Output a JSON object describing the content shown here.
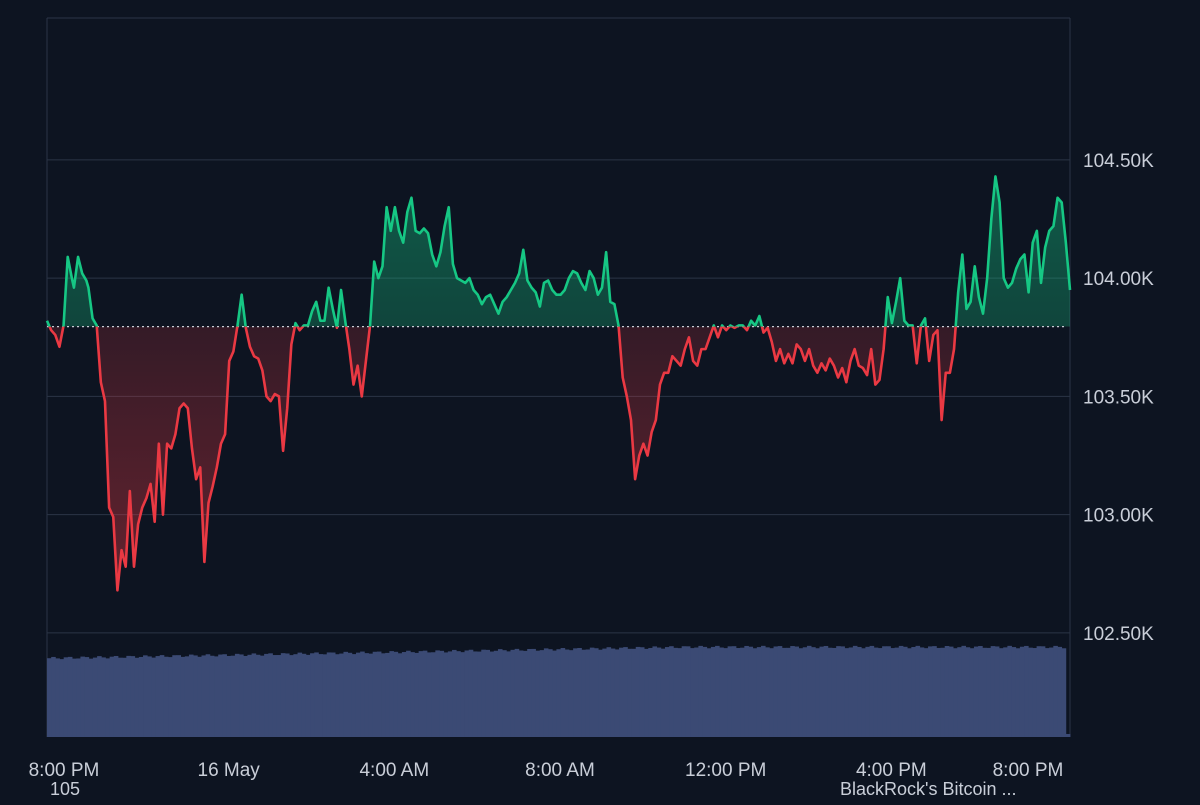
{
  "chart_data": {
    "type": "area",
    "baseline": 103795,
    "ylim": [
      102060,
      105100
    ],
    "y_ticks": [
      "104.50K",
      "104.00K",
      "103.50K",
      "103.00K",
      "102.50K"
    ],
    "y_tick_values": [
      104500,
      104000,
      103500,
      103000,
      102500
    ],
    "x_labels": [
      "8:00 PM",
      "16 May",
      "4:00 AM",
      "8:00 AM",
      "12:00 PM",
      "4:00 PM",
      "8:00 PM"
    ],
    "x_label_positions_hours": [
      0,
      4,
      8,
      12,
      16,
      20,
      24
    ],
    "x_range_hours": [
      0,
      24.7
    ],
    "price_series": {
      "x_hours": [
        0,
        0.1,
        0.2,
        0.3,
        0.4,
        0.5,
        0.6,
        0.65,
        0.75,
        0.85,
        0.95,
        1.0,
        1.1,
        1.2,
        1.3,
        1.4,
        1.5,
        1.6,
        1.7,
        1.8,
        1.9,
        2.0,
        2.1,
        2.2,
        2.3,
        2.4,
        2.5,
        2.6,
        2.7,
        2.8,
        2.9,
        3.0,
        3.1,
        3.2,
        3.3,
        3.4,
        3.5,
        3.6,
        3.7,
        3.8,
        3.9,
        4.0,
        4.1,
        4.2,
        4.3,
        4.4,
        4.5,
        4.6,
        4.7,
        4.8,
        4.9,
        5.0,
        5.1,
        5.2,
        5.3,
        5.4,
        5.5,
        5.6,
        5.7,
        5.8,
        5.9,
        6.0,
        6.1,
        6.2,
        6.3,
        6.4,
        6.5,
        6.6,
        6.7,
        6.8,
        6.9,
        7.0,
        7.1,
        7.2,
        7.3,
        7.4,
        7.5,
        7.6,
        7.7,
        7.8,
        7.9,
        8.0,
        8.1,
        8.2,
        8.3,
        8.4,
        8.5,
        8.6,
        8.7,
        8.8,
        8.9,
        9.0,
        9.1,
        9.2,
        9.3,
        9.4,
        9.5,
        9.6,
        9.7,
        9.8,
        9.9,
        10.0,
        10.1,
        10.2,
        10.3,
        10.4,
        10.5,
        10.6,
        10.7,
        10.8,
        10.9,
        11.0,
        11.1,
        11.2,
        11.3,
        11.4,
        11.5,
        11.6,
        11.7,
        11.8,
        11.9,
        12.0,
        12.1,
        12.2,
        12.3,
        12.4,
        12.5,
        12.6,
        12.7,
        12.8,
        12.9,
        13.0,
        13.1,
        13.2,
        13.3,
        13.4,
        13.5,
        13.6,
        13.7,
        13.8,
        13.9,
        14.0,
        14.1,
        14.2,
        14.3,
        14.4,
        14.5,
        14.6,
        14.7,
        14.8,
        14.9,
        15.0,
        15.1,
        15.2,
        15.3,
        15.4,
        15.5,
        15.6,
        15.7,
        15.8,
        15.9,
        16.0,
        16.1,
        16.2,
        16.3,
        16.4,
        16.5,
        16.6,
        16.7,
        16.8,
        16.9,
        17.0,
        17.1,
        17.2,
        17.3,
        17.4,
        17.5,
        17.6,
        17.7,
        17.8,
        17.9,
        18.0,
        18.1,
        18.2,
        18.3,
        18.4,
        18.5,
        18.6,
        18.7,
        18.8,
        18.9,
        19.0,
        19.1,
        19.2,
        19.3,
        19.4,
        19.5,
        19.6,
        19.7,
        19.8,
        19.9,
        20.0,
        20.1,
        20.2,
        20.3,
        20.4,
        20.5,
        20.6,
        20.7,
        20.8,
        20.9,
        21.0,
        21.1,
        21.2,
        21.3,
        21.4,
        21.5,
        21.6,
        21.7,
        21.8,
        21.9,
        22.0,
        22.1,
        22.2,
        22.3,
        22.4,
        22.5,
        22.6,
        22.7,
        22.8,
        22.9,
        23.0,
        23.1,
        23.2,
        23.3,
        23.4,
        23.5,
        23.6,
        23.7,
        23.8,
        23.9,
        24.0,
        24.1,
        24.2,
        24.3,
        24.4,
        24.5,
        24.6,
        24.7
      ],
      "y_values": [
        103820,
        103780,
        103760,
        103710,
        103800,
        104090,
        104000,
        103960,
        104090,
        104020,
        103990,
        103960,
        103830,
        103800,
        103560,
        103480,
        103030,
        102990,
        102680,
        102850,
        102780,
        103100,
        102780,
        102960,
        103030,
        103070,
        103130,
        102970,
        103300,
        103000,
        103300,
        103280,
        103340,
        103450,
        103470,
        103450,
        103280,
        103150,
        103200,
        102800,
        103050,
        103120,
        103200,
        103300,
        103340,
        103650,
        103690,
        103800,
        103930,
        103790,
        103710,
        103670,
        103660,
        103610,
        103500,
        103480,
        103510,
        103500,
        103270,
        103450,
        103720,
        103810,
        103780,
        103800,
        103800,
        103860,
        103900,
        103820,
        103820,
        103960,
        103870,
        103790,
        103950,
        103820,
        103700,
        103550,
        103630,
        103500,
        103650,
        103800,
        104070,
        104000,
        104050,
        104300,
        104200,
        104300,
        104200,
        104150,
        104280,
        104340,
        104200,
        104190,
        104210,
        104190,
        104100,
        104050,
        104110,
        104220,
        104300,
        104060,
        104000,
        103990,
        103980,
        104000,
        103950,
        103930,
        103890,
        103920,
        103930,
        103890,
        103850,
        103900,
        103920,
        103950,
        103980,
        104020,
        104120,
        103990,
        103960,
        103940,
        103880,
        103980,
        103990,
        103950,
        103930,
        103930,
        103950,
        104000,
        104030,
        104020,
        103980,
        103950,
        104030,
        104000,
        103930,
        103960,
        104110,
        103900,
        103890,
        103800,
        103580,
        103500,
        103400,
        103150,
        103250,
        103300,
        103250,
        103350,
        103400,
        103550,
        103600,
        103600,
        103670,
        103650,
        103630,
        103700,
        103750,
        103650,
        103630,
        103700,
        103700,
        103750,
        103800,
        103750,
        103800,
        103780,
        103800,
        103790,
        103800,
        103800,
        103780,
        103820,
        103800,
        103840,
        103770,
        103790,
        103730,
        103650,
        103700,
        103640,
        103680,
        103640,
        103720,
        103700,
        103650,
        103700,
        103630,
        103600,
        103640,
        103610,
        103660,
        103630,
        103580,
        103620,
        103560,
        103650,
        103700,
        103630,
        103620,
        103590,
        103700,
        103550,
        103570,
        103700,
        103920,
        103810,
        103900,
        104000,
        103820,
        103800,
        103800,
        103640,
        103800,
        103830,
        103650,
        103760,
        103780,
        103400,
        103600,
        103600,
        103700,
        103940,
        104100,
        103870,
        103900,
        104050,
        103920,
        103850,
        104000,
        104250,
        104430,
        104320,
        104000,
        103960,
        103980,
        104040,
        104080,
        104100,
        103940,
        104150,
        104200,
        103980,
        104130,
        104200,
        104220,
        104340,
        104320,
        104150,
        103950,
        104000,
        103870
      ]
    },
    "volume_series": {
      "bar_count": 245,
      "level_range": [
        0.78,
        0.91
      ],
      "last_bar_level": 0.03
    },
    "baseline_color": "#c8ccd4",
    "up_color": "#16c784",
    "down_color": "#ea3943",
    "volume_color": "#3b4a74",
    "grid_color": "#2b3446",
    "axis_text_color": "#c9ced8",
    "background_color": "#0d1421"
  },
  "footer": {
    "clipped_left": "105",
    "clipped_right": "BlackRock's Bitcoin ..."
  }
}
